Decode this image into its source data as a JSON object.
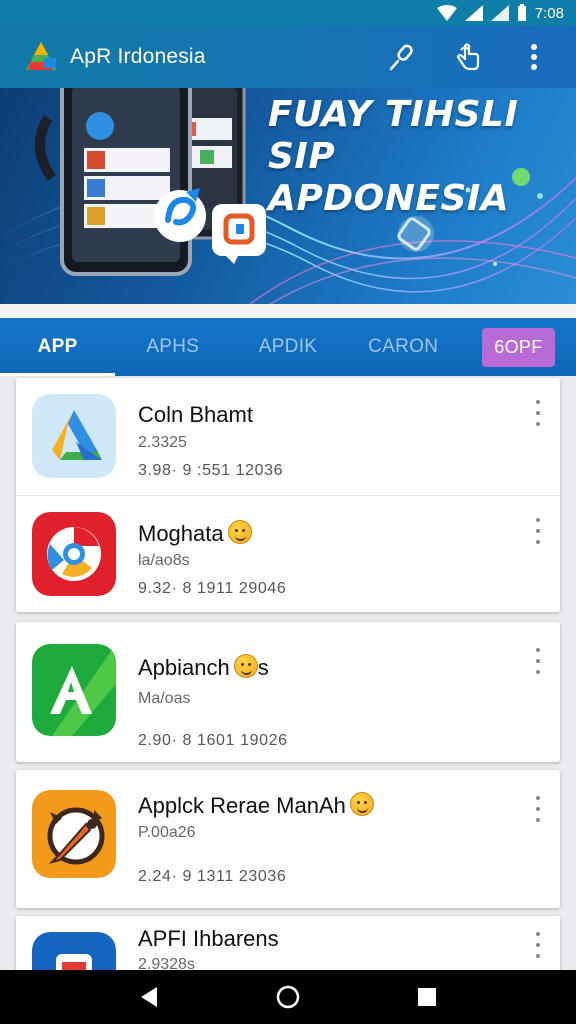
{
  "status_bar": {
    "time": "7:08"
  },
  "app_bar": {
    "title": "ApR Irdonesia"
  },
  "banner": {
    "headline_line1": "FUAY TIHSLI SIP",
    "headline_line2": "APDONESIA"
  },
  "tabs": [
    {
      "label": "APP",
      "active": true
    },
    {
      "label": "APHS",
      "active": false
    },
    {
      "label": "APDIK",
      "active": false
    },
    {
      "label": "CARON",
      "active": false
    },
    {
      "label": "6OPF",
      "active": false
    }
  ],
  "apps": [
    {
      "name": "Coln Bhamt",
      "sub": "2.3325",
      "meta": "3.98· 9  :551  12036",
      "icon": "drive-triangle-icon",
      "emoji": false
    },
    {
      "name": "Moghata",
      "sub": "la/ao8s",
      "meta": "9.32· 8  1911  29046",
      "icon": "chrome-icon",
      "emoji": true
    },
    {
      "name": "Apbianch",
      "name_suffix": "s",
      "sub": "Ma/oas",
      "meta": "2.90· 8  1601  19026",
      "icon": "green-a-icon",
      "emoji": true
    },
    {
      "name": "Applck Rerae ManAh",
      "sub": "P.00a26",
      "meta": "2.24· 9  1311  23036",
      "icon": "pencil-compass-icon",
      "emoji": true
    },
    {
      "name": "APFI Ihbarens",
      "sub": "2.9328s",
      "meta": "",
      "icon": "blue-app-icon",
      "emoji": false
    }
  ],
  "colors": {
    "appbar": "#1773b3",
    "tabbar": "#1576c9",
    "pill": "#b86bd6"
  }
}
